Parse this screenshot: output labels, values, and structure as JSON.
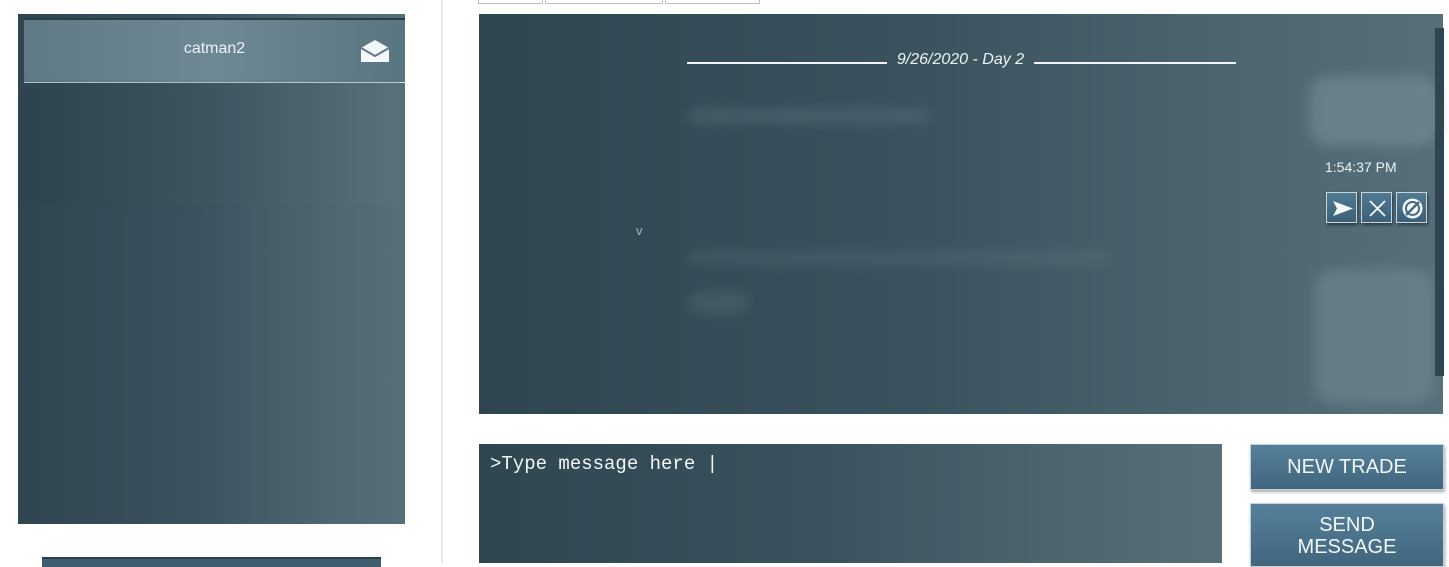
{
  "sidebar": {
    "contact_name": "catman2",
    "icons": {
      "mail": "envelope-open-icon"
    }
  },
  "chat": {
    "date_label": "9/26/2020 - Day 2",
    "timestamp": "1:54:37 PM",
    "faint_marker": "v",
    "actions": [
      {
        "name": "send-icon",
        "icon": "arrow-right"
      },
      {
        "name": "close-icon",
        "icon": "x"
      },
      {
        "name": "block-icon",
        "icon": "no-entry"
      }
    ]
  },
  "composer": {
    "input_value": ">Type message here |"
  },
  "buttons": {
    "new_trade": "NEW TRADE",
    "send_message_line1": "SEND",
    "send_message_line2": "MESSAGE"
  },
  "colors": {
    "panel_dark": "#2f4651",
    "panel_light": "#576f79",
    "button_blue": "#4a7189",
    "text_light": "#eef3f5"
  }
}
